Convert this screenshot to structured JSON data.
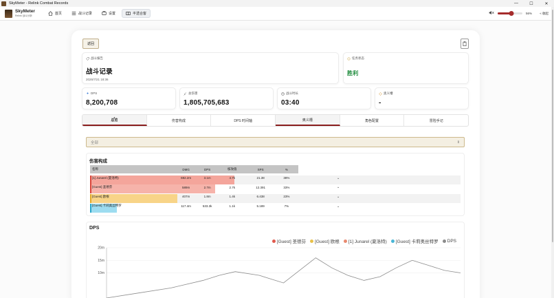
{
  "window": {
    "title": "SkyMeter - Relink Combat Records",
    "minimize": "—",
    "maximize": "☐",
    "close": "✕"
  },
  "brand": {
    "name": "SkyMeter",
    "subtitle": "Relink 战斗分析"
  },
  "nav": [
    {
      "label": "首页",
      "icon": "home-icon"
    },
    {
      "label": "战斗记录",
      "icon": "list-icon"
    },
    {
      "label": "设置",
      "icon": "settings-icon"
    },
    {
      "label": "半透合客",
      "icon": "window-icon",
      "active": true
    }
  ],
  "volume": {
    "percent_label": "56%",
    "value": 0.56
  },
  "header_right": {
    "collapse_label": "« 收起"
  },
  "buttons": {
    "back": "返回"
  },
  "cards": {
    "report": {
      "label": "战斗报告",
      "title": "战斗记录",
      "date": "2026/7/21 18:36"
    },
    "task": {
      "label": "任务状态",
      "value": "胜利"
    },
    "dps": {
      "label": "DPS",
      "value": "8,200,708"
    },
    "total": {
      "label": "总伤害",
      "value": "1,805,705,683"
    },
    "time": {
      "label": "战斗时长",
      "value": "03:40"
    },
    "ougi": {
      "label": "奥义槽",
      "value": "-"
    }
  },
  "tabs": [
    {
      "label": "总览"
    },
    {
      "label": "伤害构成"
    },
    {
      "label": "DPS 时间轴"
    },
    {
      "label": "奥义槽"
    },
    {
      "label": "角色配置"
    },
    {
      "label": "冒险手记"
    }
  ],
  "filter": {
    "value": "全部"
  },
  "damage": {
    "title": "伤害构成",
    "columns": [
      "名称",
      "DMG",
      "DPS",
      "核攻值",
      "SPS",
      "%"
    ],
    "rows": [
      {
        "name": "[1] Junarel (夏洛特)",
        "dmg": "692.2m",
        "dps": "3.1m",
        "hit": "4.7k",
        "sps": "21.38",
        "pct": "38%",
        "color": "#f4a59b",
        "share": 0.38
      },
      {
        "name": "[Guest] 圣德芬",
        "dmg": "589m",
        "dps": "2.7m",
        "hit": "2.7k",
        "sps": "12.391",
        "pct": "33%",
        "color": "#f6b3aa",
        "share": 0.33
      },
      {
        "name": "[Guest] 欧根",
        "dmg": "407m",
        "dps": "1.8m",
        "hit": "1.4k",
        "sps": "6.438",
        "pct": "23%",
        "color": "#f8d488",
        "share": 0.23
      },
      {
        "name": "[Guest] 卡莉奥丝特罗",
        "dmg": "117.4m",
        "dps": "533.3k",
        "hit": "1.1k",
        "sps": "5.189",
        "pct": "7%",
        "color": "#9ddcf0",
        "share": 0.07
      }
    ]
  },
  "chart_data": {
    "type": "line",
    "title": "DPS",
    "legend": [
      {
        "name": "[Guest] 圣德芬",
        "color": "#e05a4e"
      },
      {
        "name": "[Guest] 欧根",
        "color": "#e8c14a"
      },
      {
        "name": "[1] Junarel (夏洛特)",
        "color": "#e98a6f"
      },
      {
        "name": "[Guest] 卡莉奥丝特罗",
        "color": "#4ab6d6"
      },
      {
        "name": "DPS",
        "color": "#8c8c8c"
      }
    ],
    "y_ticks": [
      "20m",
      "15m",
      "10m"
    ],
    "y_range": [
      0,
      20
    ],
    "x_range": [
      0,
      220
    ],
    "series": [
      {
        "name": "DPS",
        "color": "#8c8c8c",
        "x": [
          0,
          20,
          40,
          60,
          70,
          80,
          95,
          110,
          120,
          130,
          140,
          150,
          160,
          170,
          180,
          190,
          200,
          210,
          220
        ],
        "y": [
          0,
          2,
          4,
          7,
          9,
          10.5,
          9,
          6,
          11,
          16,
          12,
          9,
          7,
          8.5,
          12,
          15,
          13,
          11,
          10
        ]
      }
    ]
  }
}
